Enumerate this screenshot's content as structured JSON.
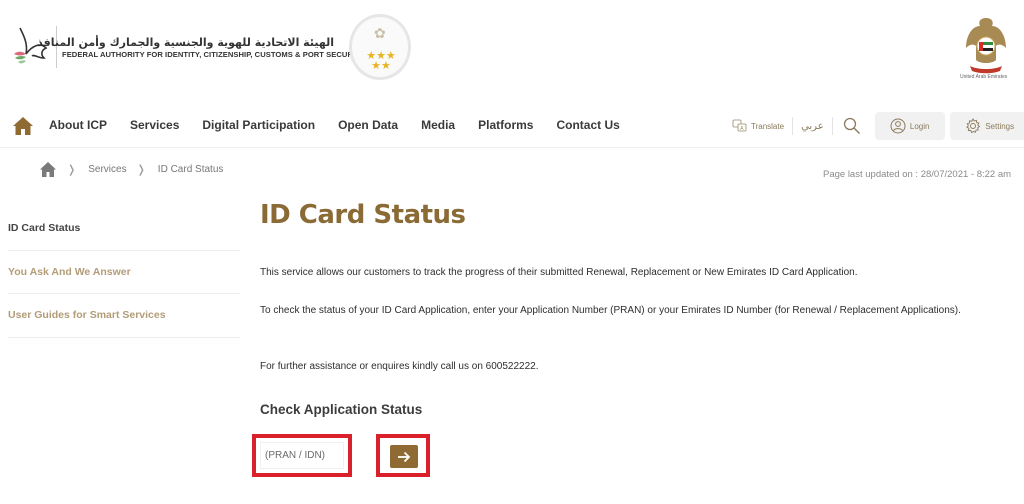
{
  "header": {
    "org_name_ar": "الهيئة الاتحادية للهوية والجنسية والجمارك وأمن المنافذ",
    "org_name_en": "FEDERAL AUTHORITY FOR IDENTITY, CITIZENSHIP, CUSTOMS & PORT SECURITY",
    "award_stars": "★★★ ★★",
    "emblem_label": "United Arab Emirates"
  },
  "nav": {
    "items": [
      {
        "label": "About ICP"
      },
      {
        "label": "Services"
      },
      {
        "label": "Digital Participation"
      },
      {
        "label": "Open Data"
      },
      {
        "label": "Media"
      },
      {
        "label": "Platforms"
      },
      {
        "label": "Contact Us"
      }
    ],
    "translate_label": "Translate",
    "arabic_label": "عربي",
    "login_label": "Login",
    "settings_label": "Settings"
  },
  "breadcrumb": {
    "items": [
      {
        "label": "Services"
      },
      {
        "label": "ID Card Status"
      }
    ],
    "separator": "❭"
  },
  "page_updated": "Page last updated on : 28/07/2021 - 8:22 am",
  "sidebar": {
    "items": [
      {
        "label": "ID Card Status",
        "active": true
      },
      {
        "label": "You Ask And We Answer",
        "active": false
      },
      {
        "label": "User Guides for Smart Services",
        "active": false
      }
    ]
  },
  "main": {
    "title": "ID Card Status",
    "paragraph_1": "This service allows our customers to track the progress of their submitted Renewal, Replacement or New Emirates ID Card Application.",
    "paragraph_2": "To check the status of your ID Card Application, enter your Application Number (PRAN) or your Emirates ID Number (for Renewal / Replacement Applications).",
    "paragraph_3": "For further assistance or enquires kindly call us on 600522222.",
    "check_title": "Check Application Status",
    "input_placeholder": "(PRAN / IDN)",
    "input_value": ""
  },
  "colors": {
    "brand_gold": "#8a6a35",
    "button_gold": "#8f6b33",
    "highlight_red": "#d9202b",
    "sidebar_inactive": "#b39c77"
  }
}
